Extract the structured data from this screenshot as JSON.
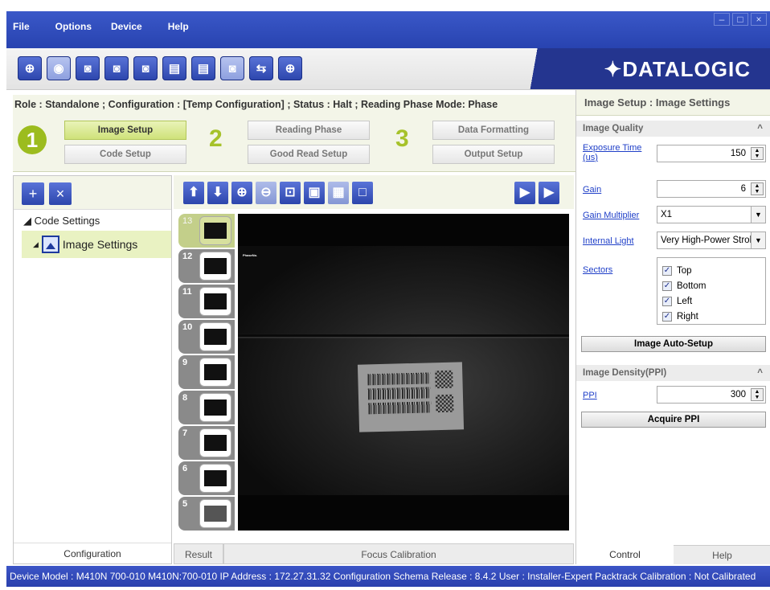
{
  "menu": [
    "File",
    "Options",
    "Device",
    "Help"
  ],
  "toolbar": {
    "icons": [
      "connect-icon",
      "camera-settings-icon",
      "camera-add-icon",
      "camera-export-icon",
      "camera-save-icon",
      "window-export-icon",
      "window-save-icon",
      "camera-disabled-icon",
      "transfer-icon",
      "crosshair-icon"
    ],
    "logo": "✦DATALOGIC"
  },
  "status_line": "Role : Standalone ; Configuration : [Temp Configuration] ; Status : Halt ; Reading Phase Mode: Phase",
  "steps": {
    "num1": "1",
    "num2": "2",
    "num3": "3",
    "image_setup": "Image Setup",
    "code_setup": "Code Setup",
    "reading_phase": "Reading Phase",
    "good_read_setup": "Good Read Setup",
    "data_formatting": "Data Formatting",
    "output_setup": "Output Setup"
  },
  "left_panel": {
    "tree_root": "Code Settings",
    "tree_child": "Image Settings",
    "footer": "Configuration"
  },
  "center": {
    "thumbnails": [
      "13",
      "12",
      "11",
      "10",
      "9",
      "8",
      "7",
      "6",
      "5"
    ],
    "selected_thumb": "13",
    "phase_label": "PhaseNo.",
    "tab_result": "Result",
    "tab_focus": "Focus Calibration"
  },
  "right_panel": {
    "title": "Image Setup : Image Settings",
    "image_quality": "Image Quality",
    "exposure_label": "Exposure Time (us)",
    "exposure_value": "150",
    "gain_label": "Gain",
    "gain_value": "6",
    "gain_mult_label": "Gain Multiplier",
    "gain_mult_value": "X1",
    "internal_light_label": "Internal Light",
    "internal_light_value": "Very High-Power Strobe",
    "sectors_label": "Sectors",
    "sectors": [
      "Top",
      "Bottom",
      "Left",
      "Right"
    ],
    "auto_setup": "Image Auto-Setup",
    "density_title": "Image Density(PPI)",
    "ppi_label": "PPI",
    "ppi_value": "300",
    "acquire_ppi": "Acquire PPI",
    "tab_control": "Control",
    "tab_help": "Help"
  },
  "statusbar": "Device Model : M410N  700-010  M410N:700-010  IP Address : 172.27.31.32  Configuration Schema Release : 8.4.2  User : Installer-Expert  Packtrack Calibration : Not Calibrated"
}
